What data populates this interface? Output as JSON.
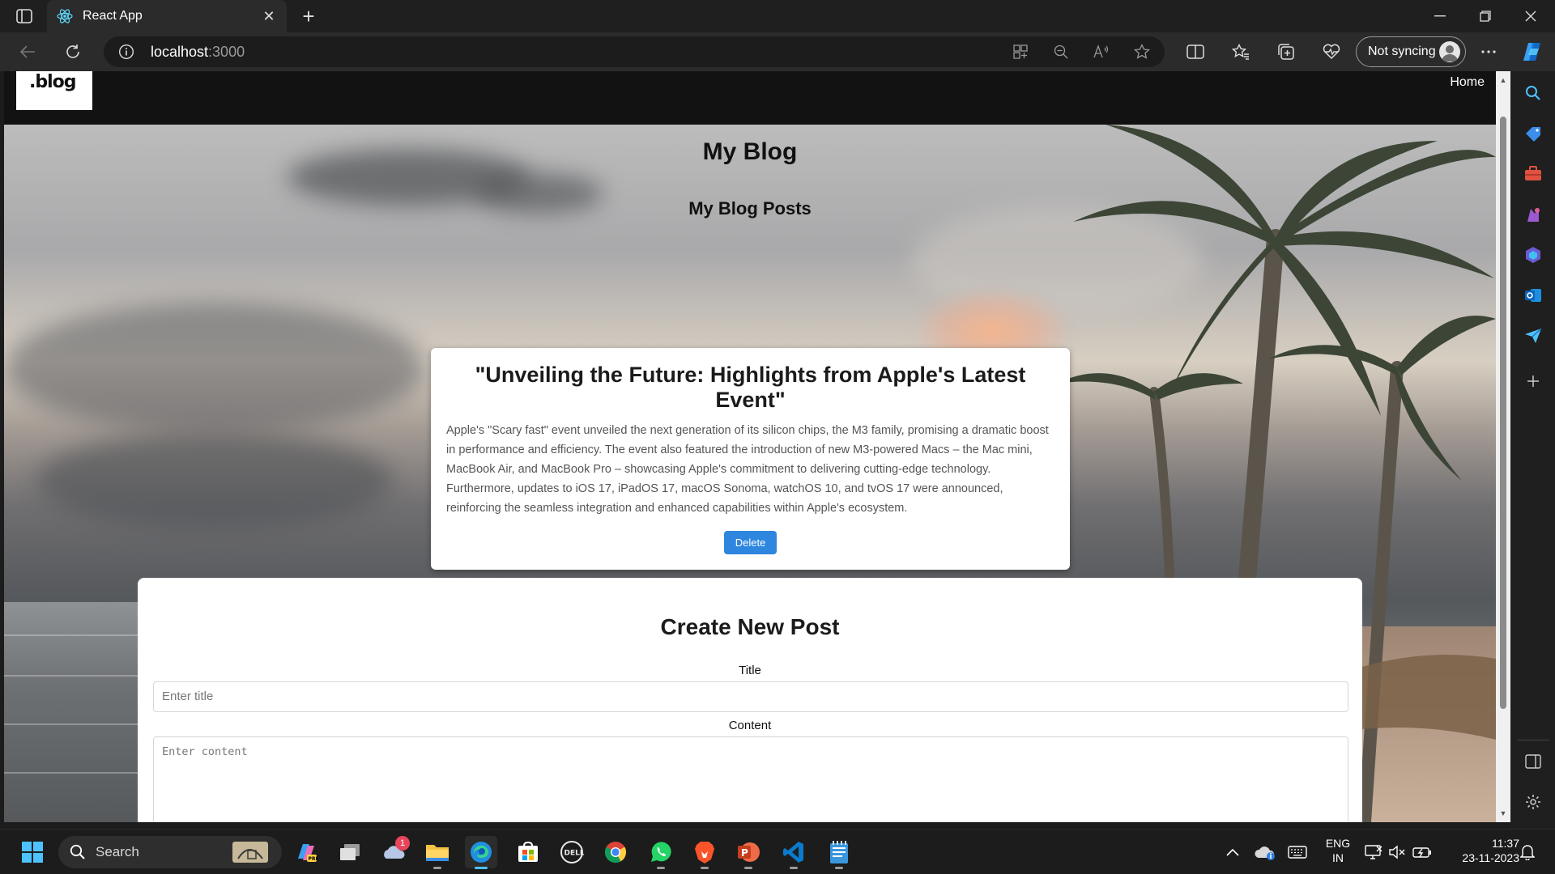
{
  "browser": {
    "tab_title": "React App",
    "url_host": "localhost",
    "url_port": ":3000",
    "sync_label": "Not syncing"
  },
  "page": {
    "logo_text": ".blog",
    "nav_home": "Home",
    "heading": "My Blog",
    "subheading": "My Blog Posts",
    "post": {
      "title": "\"Unveiling the Future: Highlights from Apple's Latest Event\"",
      "content": "Apple's \"Scary fast\" event unveiled the next generation of its silicon chips, the M3 family, promising a dramatic boost in performance and efficiency. The event also featured the introduction of new M3-powered Macs – the Mac mini, MacBook Air, and MacBook Pro – showcasing Apple's commitment to delivering cutting-edge technology. Furthermore, updates to iOS 17, iPadOS 17, macOS Sonoma, watchOS 10, and tvOS 17 were announced, reinforcing the seamless integration and enhanced capabilities within Apple's ecosystem.",
      "delete_label": "Delete"
    },
    "create": {
      "heading": "Create New Post",
      "title_label": "Title",
      "title_placeholder": "Enter title",
      "content_label": "Content",
      "content_placeholder": "Enter content"
    }
  },
  "taskbar": {
    "search_label": "Search",
    "notification_badge": "1",
    "lang_top": "ENG",
    "lang_bottom": "IN",
    "time": "11:37",
    "date": "23-11-2023"
  },
  "colors": {
    "accent_button": "#2e86de",
    "navbar": "#121212",
    "edge_blue": "#4cc2ff"
  }
}
